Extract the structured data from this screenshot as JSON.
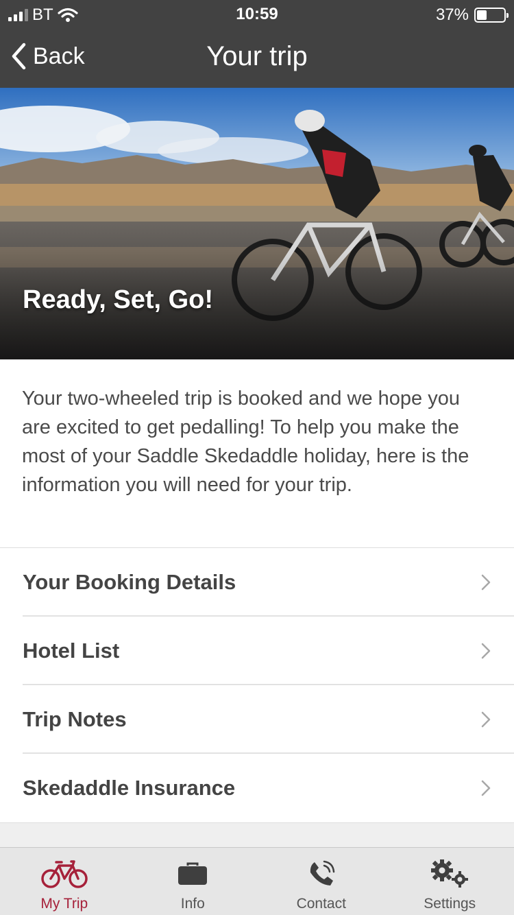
{
  "status_bar": {
    "carrier": "BT",
    "time": "10:59",
    "battery": "37%",
    "battery_level": 0.37
  },
  "nav": {
    "back_label": "Back",
    "title": "Your trip"
  },
  "hero": {
    "caption": "Ready, Set, Go!"
  },
  "intro": {
    "text": "Your two-wheeled trip is booked and we hope you are excited to get pedalling! To help you make the most of your Saddle Skedaddle holiday, here is the information you will need for your trip."
  },
  "menu": {
    "items": [
      {
        "label": "Your Booking Details"
      },
      {
        "label": "Hotel List"
      },
      {
        "label": "Trip Notes"
      },
      {
        "label": "Skedaddle Insurance"
      }
    ]
  },
  "tabs": [
    {
      "label": "My Trip",
      "icon": "bicycle-icon",
      "active": true
    },
    {
      "label": "Info",
      "icon": "briefcase-icon",
      "active": false
    },
    {
      "label": "Contact",
      "icon": "phone-icon",
      "active": false
    },
    {
      "label": "Settings",
      "icon": "gears-icon",
      "active": false
    }
  ],
  "colors": {
    "header_bg": "#424242",
    "accent": "#a6213a",
    "tabbar_bg": "#e6e6e6"
  }
}
